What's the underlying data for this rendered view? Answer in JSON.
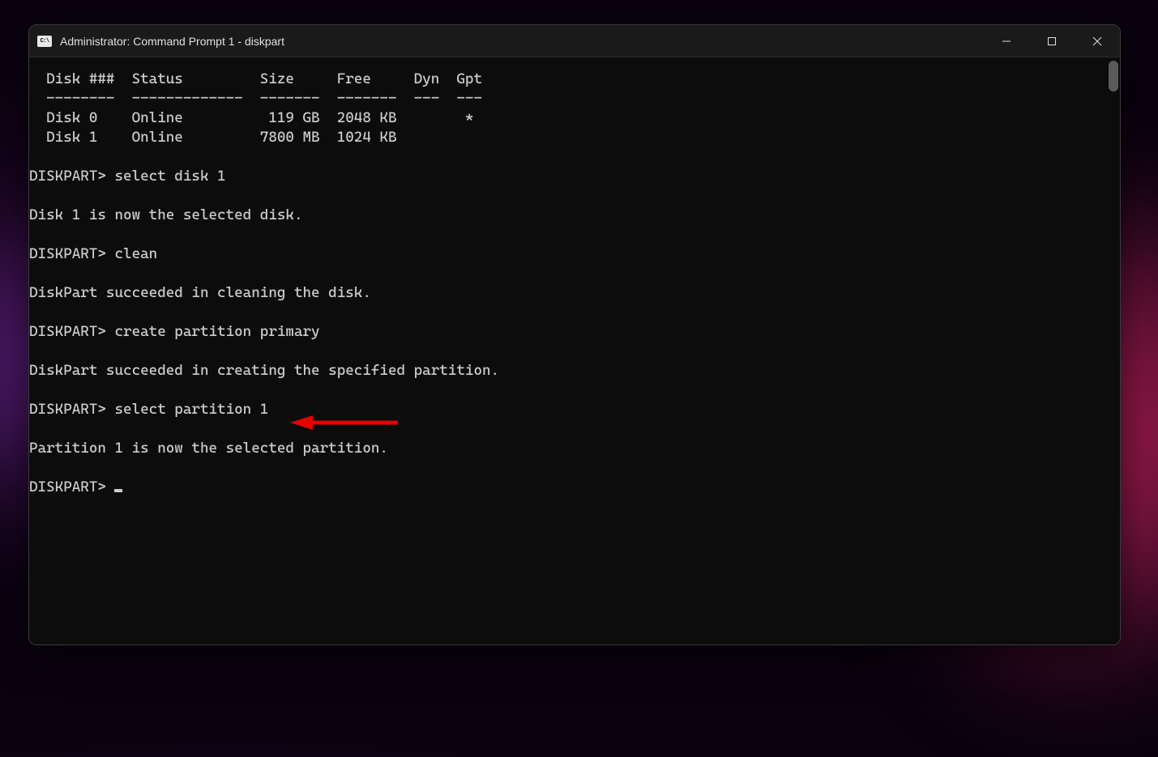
{
  "window": {
    "title": "Administrator: Command Prompt 1 - diskpart"
  },
  "terminal": {
    "header_line": "  Disk ###  Status         Size     Free     Dyn  Gpt",
    "separator_line": "  --------  -------------  -------  -------  ---  ---",
    "disk_rows": [
      "  Disk 0    Online          119 GB  2048 KB        *",
      "  Disk 1    Online         7800 MB  1024 KB"
    ],
    "blocks": [
      {
        "prompt": "DISKPART> ",
        "command": "select disk 1",
        "response": "Disk 1 is now the selected disk."
      },
      {
        "prompt": "DISKPART> ",
        "command": "clean",
        "response": "DiskPart succeeded in cleaning the disk."
      },
      {
        "prompt": "DISKPART> ",
        "command": "create partition primary",
        "response": "DiskPart succeeded in creating the specified partition."
      },
      {
        "prompt": "DISKPART> ",
        "command": "select partition 1",
        "response": "Partition 1 is now the selected partition."
      }
    ],
    "final_prompt": "DISKPART> "
  },
  "annotation": {
    "arrow_color": "#e60000"
  }
}
